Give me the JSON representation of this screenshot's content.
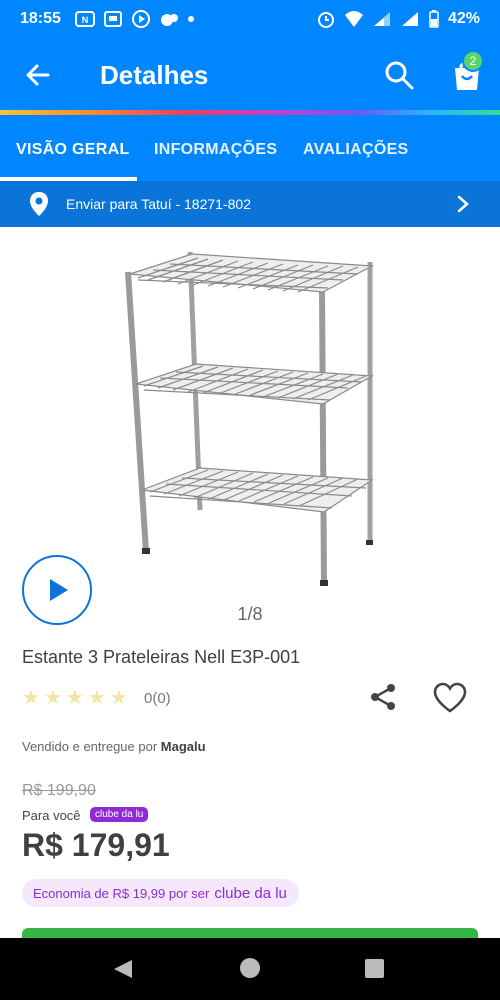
{
  "status_bar": {
    "time": "18:55",
    "battery": "42%",
    "icons": [
      "nubank-icon",
      "messages-icon",
      "play-icon",
      "whatsapp-icon",
      "dot-icon",
      "alarm-icon",
      "wifi-icon",
      "signal-icon",
      "signal-icon",
      "battery-icon"
    ]
  },
  "app_bar": {
    "title": "Detalhes",
    "cart_count": "2"
  },
  "tabs": [
    {
      "label": "VISÃO GERAL",
      "active": true
    },
    {
      "label": "INFORMAÇÕES",
      "active": false
    },
    {
      "label": "AVALIAÇÕES",
      "active": false
    }
  ],
  "shipping": {
    "label": "Enviar para Tatuí - 18271-802"
  },
  "gallery": {
    "pager": "1/8"
  },
  "product": {
    "title": "Estante 3 Prateleiras Nell E3P-001",
    "rating_count": "0(0)",
    "stars_filled": 0,
    "stars_total": 5,
    "seller_prefix": "Vendido e entregue por",
    "seller_name": "Magalu",
    "old_price": "R$ 199,90",
    "para_voce": "Para você",
    "clube_badge": "clube da lu",
    "price": "R$ 179,91",
    "economia_text": "Economia de R$ 19,99 por ser",
    "economia_brand": "clube da lu"
  },
  "colors": {
    "primary": "#0086ff",
    "ship_bar": "#0a74d8",
    "buy_green": "#35b644",
    "clube_purple": "#8f2bd6",
    "badge_green": "#5ad36b"
  }
}
